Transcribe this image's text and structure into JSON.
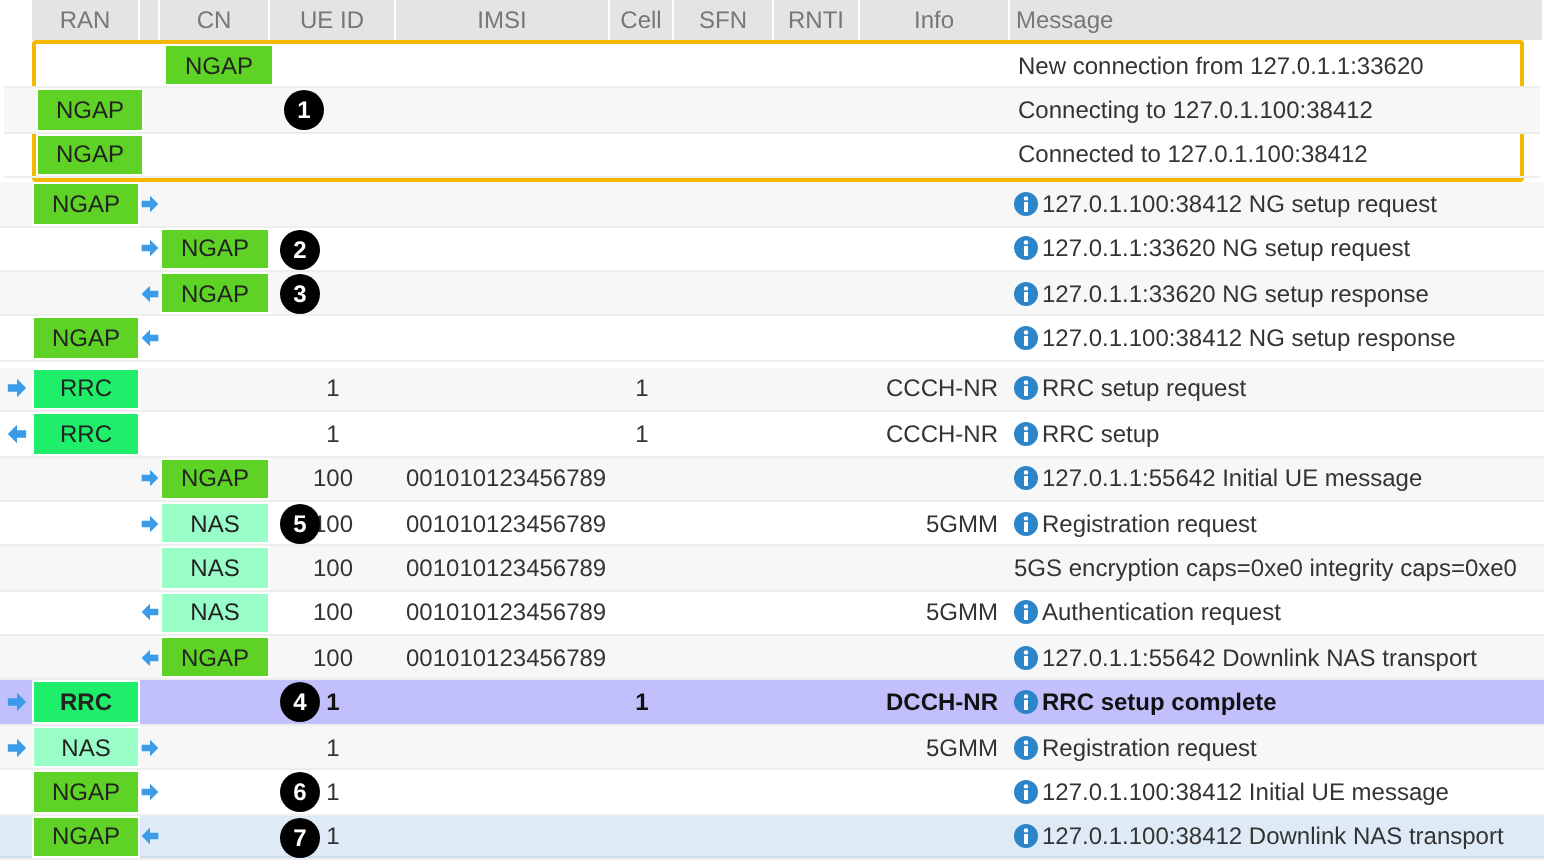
{
  "table": {
    "columns": [
      "RAN",
      "CN",
      "UE ID",
      "IMSI",
      "Cell",
      "SFN",
      "RNTI",
      "Info",
      "Message"
    ],
    "rows": [
      {
        "cn": {
          "label": "NGAP",
          "kind": "ngap"
        },
        "message": "New connection from 127.0.1.1:33620",
        "info_icon": false,
        "framed": true,
        "selected": false,
        "highlighted": false
      },
      {
        "ran": {
          "label": "NGAP",
          "kind": "ngap"
        },
        "message": "Connecting to 127.0.1.100:38412",
        "info_icon": false,
        "framed": true,
        "callout": "1",
        "selected": false,
        "highlighted": false
      },
      {
        "ran": {
          "label": "NGAP",
          "kind": "ngap"
        },
        "message": "Connected to 127.0.1.100:38412",
        "info_icon": false,
        "framed": true,
        "selected": false,
        "highlighted": false
      },
      {
        "ran": {
          "label": "NGAP",
          "kind": "ngap"
        },
        "mid_arrow": {
          "kind": "right"
        },
        "message": "127.0.1.100:38412 NG setup request",
        "info_icon": true,
        "framed": false,
        "selected": false,
        "highlighted": false
      },
      {
        "mid_arrow": {
          "kind": "right"
        },
        "cn": {
          "label": "NGAP",
          "kind": "ngap"
        },
        "message": "127.0.1.1:33620 NG setup request",
        "info_icon": true,
        "framed": false,
        "callout": "2",
        "selected": false,
        "highlighted": false
      },
      {
        "mid_arrow": {
          "kind": "left"
        },
        "cn": {
          "label": "NGAP",
          "kind": "ngap"
        },
        "message": "127.0.1.1:33620 NG setup response",
        "info_icon": true,
        "framed": false,
        "callout": "3",
        "selected": false,
        "highlighted": false
      },
      {
        "ran": {
          "label": "NGAP",
          "kind": "ngap"
        },
        "mid_arrow": {
          "kind": "left"
        },
        "message": "127.0.1.100:38412 NG setup response",
        "info_icon": true,
        "framed": false,
        "selected": false,
        "highlighted": false
      },
      {
        "ue_arrow": {
          "kind": "right"
        },
        "ran": {
          "label": "RRC",
          "kind": "rrc"
        },
        "ue_id": "1",
        "cell": "1",
        "info": "CCCH-NR",
        "message": "RRC setup request",
        "info_icon": true,
        "framed": false,
        "selected": false,
        "highlighted": false
      },
      {
        "ue_arrow": {
          "kind": "left"
        },
        "ran": {
          "label": "RRC",
          "kind": "rrc"
        },
        "ue_id": "1",
        "cell": "1",
        "info": "CCCH-NR",
        "message": "RRC setup",
        "info_icon": true,
        "framed": false,
        "selected": false,
        "highlighted": false
      },
      {
        "mid_arrow": {
          "kind": "right"
        },
        "cn": {
          "label": "NGAP",
          "kind": "ngap"
        },
        "ue_id": "100",
        "imsi": "001010123456789",
        "message": "127.0.1.1:55642 Initial UE message",
        "info_icon": true,
        "framed": false,
        "selected": false,
        "highlighted": false
      },
      {
        "mid_arrow": {
          "kind": "right"
        },
        "cn": {
          "label": "NAS",
          "kind": "nas"
        },
        "ue_id": "100",
        "imsi": "001010123456789",
        "info": "5GMM",
        "message": "Registration request",
        "info_icon": true,
        "framed": false,
        "callout": "5",
        "selected": false,
        "highlighted": false
      },
      {
        "cn": {
          "label": "NAS",
          "kind": "nas"
        },
        "ue_id": "100",
        "imsi": "001010123456789",
        "message": "5GS encryption caps=0xe0 integrity caps=0xe0",
        "info_icon": false,
        "framed": false,
        "selected": false,
        "highlighted": false
      },
      {
        "mid_arrow": {
          "kind": "left"
        },
        "cn": {
          "label": "NAS",
          "kind": "nas"
        },
        "ue_id": "100",
        "imsi": "001010123456789",
        "info": "5GMM",
        "message": "Authentication request",
        "info_icon": true,
        "framed": false,
        "selected": false,
        "highlighted": false
      },
      {
        "mid_arrow": {
          "kind": "left"
        },
        "cn": {
          "label": "NGAP",
          "kind": "ngap"
        },
        "ue_id": "100",
        "imsi": "001010123456789",
        "message": "127.0.1.1:55642 Downlink NAS transport",
        "info_icon": true,
        "framed": false,
        "selected": false,
        "highlighted": false
      },
      {
        "ue_arrow": {
          "kind": "right"
        },
        "ran": {
          "label": "RRC",
          "kind": "rrc"
        },
        "ue_id": "1",
        "cell": "1",
        "info": "DCCH-NR",
        "message": "RRC setup complete",
        "info_icon": true,
        "framed": false,
        "callout": "4",
        "selected": true,
        "highlighted": false
      },
      {
        "ue_arrow": {
          "kind": "right"
        },
        "ran": {
          "label": "NAS",
          "kind": "nas"
        },
        "mid_arrow": {
          "kind": "right"
        },
        "ue_id": "1",
        "info": "5GMM",
        "message": "Registration request",
        "info_icon": true,
        "framed": false,
        "selected": false,
        "highlighted": false
      },
      {
        "ran": {
          "label": "NGAP",
          "kind": "ngap"
        },
        "mid_arrow": {
          "kind": "right"
        },
        "ue_id": "1",
        "message": "127.0.1.100:38412 Initial UE message",
        "info_icon": true,
        "framed": false,
        "callout": "6",
        "selected": false,
        "highlighted": false
      },
      {
        "ran": {
          "label": "NGAP",
          "kind": "ngap"
        },
        "mid_arrow": {
          "kind": "left"
        },
        "ue_id": "1",
        "message": "127.0.1.100:38412 Downlink NAS transport",
        "info_icon": true,
        "framed": false,
        "callout": "7",
        "selected": false,
        "highlighted": true
      }
    ]
  }
}
